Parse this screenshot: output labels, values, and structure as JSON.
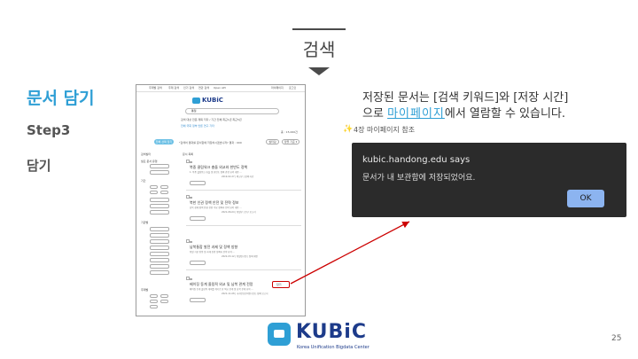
{
  "header": {
    "title": "검색"
  },
  "left": {
    "heading": "문서 담기",
    "step": "Step3",
    "action": "담기"
  },
  "screenshot": {
    "nav_items": [
      "주제별 검색",
      "주제 검색",
      "인기 검색",
      "연관 검색",
      "Open API",
      "마이페이지",
      "로그인"
    ],
    "logo_text": "KUBiC",
    "search_value": "통일",
    "search_options": "검색 대상  전문  제목  저자  /  기간  전체  최근1년  최근5년",
    "category_tabs": "전체  국회  정부  언론  연구  기타",
    "total_label": "총 : 15,000건",
    "select_all_label": "전체 선택 담기",
    "save_hint": "*검색어 결과를 문서함에 저장하시겠습니까? 결과 : 000",
    "btn_filter": "필터링",
    "btn_sort": "정렬 기준 ▾",
    "sidebar": {
      "title": "검색필터",
      "type_label": "필요 문서 유형",
      "date_label": "기간",
      "org_label": "기관별",
      "topic_label": "주제별"
    },
    "results_title": "문서 목록",
    "results": [
      {
        "title": "북중 클림워크 충돌 외교와 한반도 정책",
        "snippet": "1. 북중 클림워크 충돌 및 한반도 정책 관련 요약 내용 ...",
        "meta": "2019-02-27 | 외교부 | 정책 자료"
      },
      {
        "title": "북한 인권 정책 안전 및 전략 정보",
        "snippet": "남북 경제 협력 인권 관련 주요 정책과 전략 요약 내용 ...",
        "meta": "2021-06-04 | 통일부 | 연구 보고서"
      },
      {
        "title": "남북통합 발전 과제 및 정책 방향",
        "snippet": "통일 기본 방향 및 과제 관련 정책과 전략 요약 ...",
        "meta": "2022-03-12 | 통일연구원 | 정책 제안"
      },
      {
        "title": "베이징 동계 올림픽 외교 및 남북 관계 전망",
        "snippet": "베이징 동계 올림픽 개최를 계기로 한 외교 관계 및 남북 관계 요약 ...",
        "meta": "2021-11-08 | 국가안보전략연구원 | 정책 보고서"
      }
    ],
    "save_button": "담기"
  },
  "right_text": {
    "line1": "저장된 문서는 [검색 키워드]와 [저장 시간]",
    "line2_prefix": "으로 ",
    "link": "마이페이지",
    "line2_suffix": "에서 열람할 수 있습니다.",
    "ref_note": "4장 마이페이지 참조"
  },
  "alert": {
    "site": "kubic.handong.edu says",
    "message": "문서가 내 보관함에 저장되었어요.",
    "ok_label": "OK"
  },
  "footer": {
    "logo_name": "KUBiC",
    "logo_sub": "Korea Unification Bigdata Center",
    "page_number": "25"
  },
  "colors": {
    "accent": "#2f9fd5",
    "brand": "#1d3b8a",
    "arrow": "#cc0000",
    "dialog_bg": "#2b2b2b"
  }
}
